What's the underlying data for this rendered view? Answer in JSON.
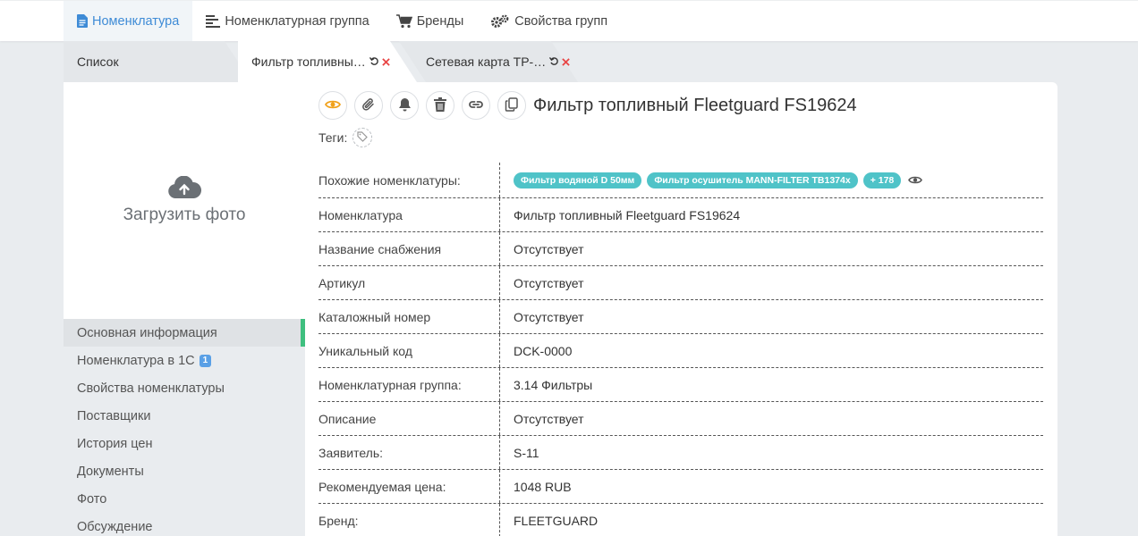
{
  "colors": {
    "accent": "#3e8bd6",
    "green_marker": "#3fbf7f",
    "chip": "#4fc3c8",
    "close": "#e84545",
    "eye_active": "#f0a11a"
  },
  "topnav": {
    "items": [
      {
        "label": "Номенклатура",
        "icon": "document-icon",
        "active": true
      },
      {
        "label": "Номенклатурная группа",
        "icon": "list-icon",
        "active": false
      },
      {
        "label": "Бренды",
        "icon": "cart-icon",
        "active": false
      },
      {
        "label": "Свойства групп",
        "icon": "gears-icon",
        "active": false
      }
    ]
  },
  "tabs": {
    "list_label": "Список",
    "active_label": "Фильтр топливны…",
    "network_label": "Сетевая карта ТР-…"
  },
  "upload": {
    "label": "Загрузить фото",
    "icon": "cloud-upload-icon"
  },
  "side_menu": {
    "items": [
      {
        "label": "Основная информация",
        "active": true
      },
      {
        "label": "Номенклатура в 1С",
        "badge": "1"
      },
      {
        "label": "Свойства номенклатуры"
      },
      {
        "label": "Поставщики"
      },
      {
        "label": "История цен"
      },
      {
        "label": "Документы"
      },
      {
        "label": "Фото"
      },
      {
        "label": "Обсуждение"
      }
    ]
  },
  "toolbar": {
    "icons": [
      "eye-icon",
      "paperclip-icon",
      "bell-icon",
      "trash-icon",
      "link-icon",
      "copy-icon"
    ]
  },
  "title": "Фильтр топливный Fleetguard FS19624",
  "tags_label": "Теги:",
  "similar": {
    "label": "Похожие номенклатуры:",
    "chips": [
      "Фильтр водяной D 50мм",
      "Фильтр осушитель MANN-FILTER TB1374x",
      "+ 178"
    ]
  },
  "properties": [
    {
      "key": "Номенклатура",
      "value": "Фильтр топливный Fleetguard FS19624"
    },
    {
      "key": "Название снабжения",
      "value": "Отсутствует"
    },
    {
      "key": "Артикул",
      "value": "Отсутствует"
    },
    {
      "key": "Каталожный номер",
      "value": "Отсутствует"
    },
    {
      "key": "Уникальный код",
      "value": "DCK-0000"
    },
    {
      "key": "Номенклатурная группа:",
      "value": "3.14 Фильтры"
    },
    {
      "key": "Описание",
      "value": "Отсутствует"
    },
    {
      "key": "Заявитель:",
      "value": "S-11"
    },
    {
      "key": "Рекомендуемая цена:",
      "value": "1048 RUB"
    },
    {
      "key": "Бренд:",
      "value": "FLEETGUARD"
    }
  ]
}
